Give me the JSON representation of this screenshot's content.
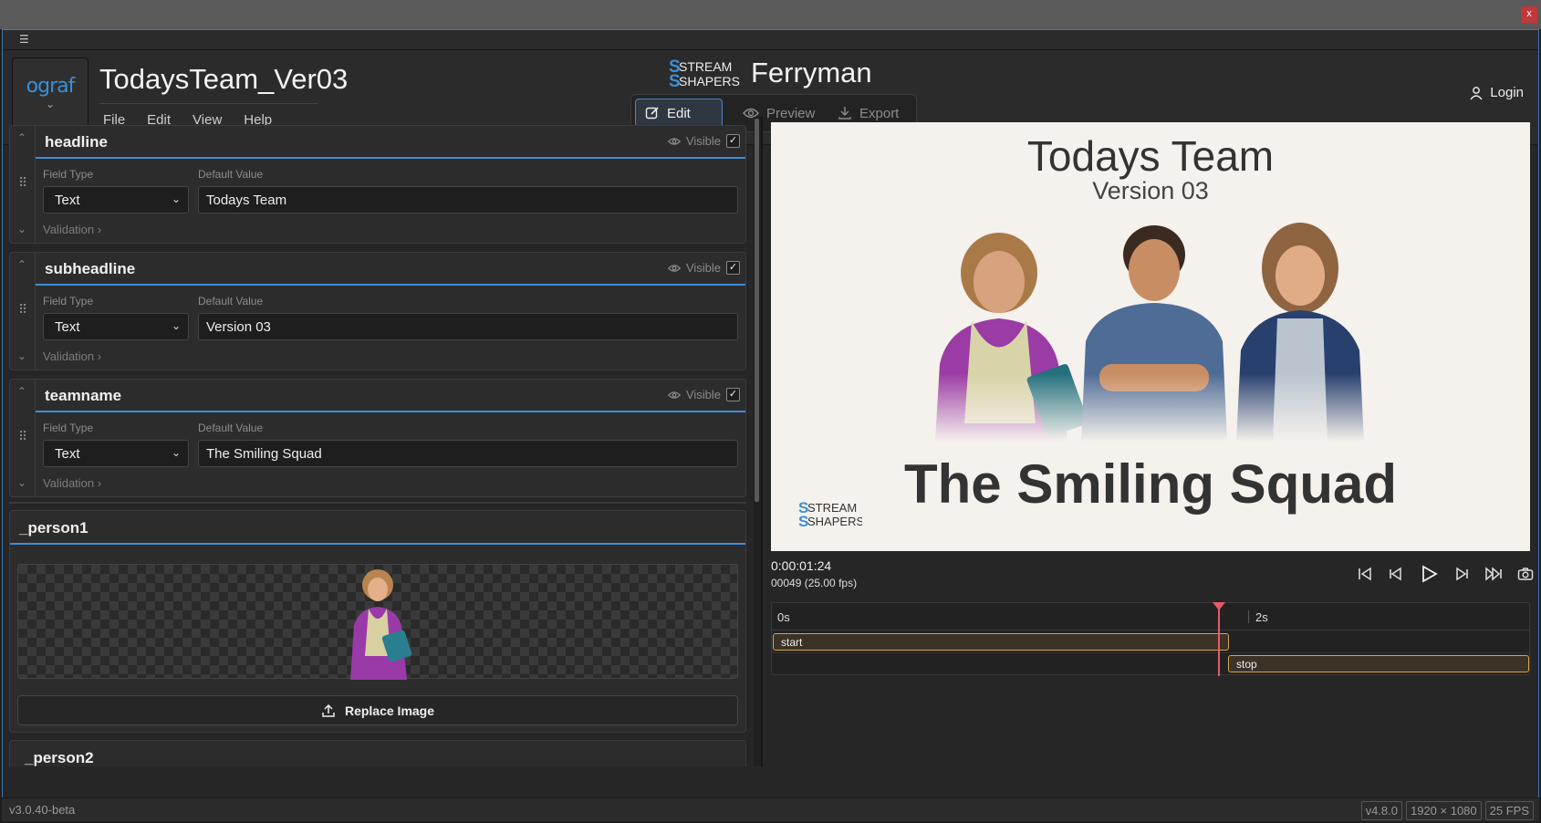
{
  "window": {
    "close_label": "x"
  },
  "header": {
    "menu_icon": "hamburger-icon",
    "logo_text": "ograf",
    "doc_title": "TodaysTeam_Ver03",
    "menus": [
      "File",
      "Edit",
      "View",
      "Help"
    ],
    "brand_name": "Ferryman",
    "brand_logo_top": "STREAM",
    "brand_logo_bottom": "SHAPERS",
    "modes": [
      {
        "label": "Edit",
        "icon": "edit-icon",
        "active": true
      },
      {
        "label": "Preview",
        "icon": "eye-icon",
        "active": false
      },
      {
        "label": "Export",
        "icon": "download-icon",
        "active": false
      }
    ],
    "login_label": "Login"
  },
  "fields": [
    {
      "name": "headline",
      "visible_label": "Visible",
      "visible": true,
      "field_type_label": "Field Type",
      "field_type": "Text",
      "default_label": "Default Value",
      "default_value": "Todays Team",
      "validation_label": "Validation"
    },
    {
      "name": "subheadline",
      "visible_label": "Visible",
      "visible": true,
      "field_type_label": "Field Type",
      "field_type": "Text",
      "default_label": "Default Value",
      "default_value": "Version 03",
      "validation_label": "Validation"
    },
    {
      "name": "teamname",
      "visible_label": "Visible",
      "visible": true,
      "field_type_label": "Field Type",
      "field_type": "Text",
      "default_label": "Default Value",
      "default_value": "The Smiling Squad",
      "validation_label": "Validation"
    }
  ],
  "image_field": {
    "name": "_person1",
    "replace_label": "Replace Image"
  },
  "next_field": {
    "name": "_person2"
  },
  "preview": {
    "title": "Todays Team",
    "subtitle": "Version 03",
    "team": "The Smiling Squad",
    "logo_top": "STREAM",
    "logo_bottom": "SHAPERS"
  },
  "playback": {
    "timecode": "0:00:01:24",
    "frames": "00049 (25.00 fps)"
  },
  "timeline": {
    "ticks": [
      "0s",
      "2s"
    ],
    "clips": [
      {
        "label": "start"
      },
      {
        "label": "stop"
      }
    ],
    "accent": "#e85a6a"
  },
  "status": {
    "version": "v3.0.40-beta",
    "badges": [
      "v4.8.0",
      "1920 × 1080",
      "25 FPS"
    ]
  }
}
